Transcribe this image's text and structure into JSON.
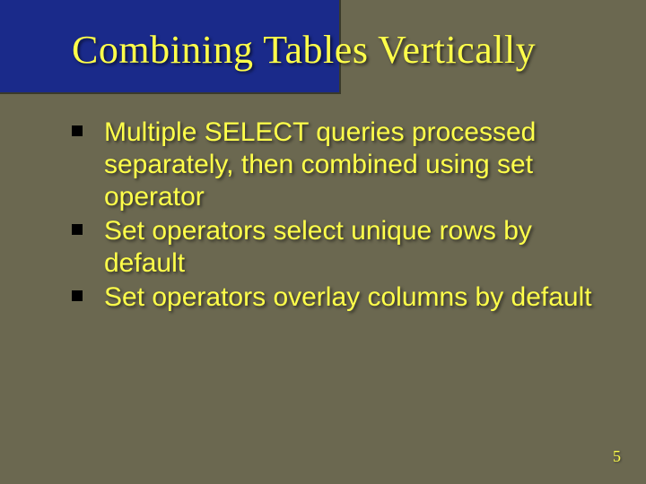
{
  "slide": {
    "title": "Combining Tables Vertically",
    "bullets": [
      "Multiple SELECT queries processed separately, then combined using set operator",
      "Set operators select unique rows by default",
      "Set operators overlay columns by default"
    ],
    "page_number": "5"
  }
}
